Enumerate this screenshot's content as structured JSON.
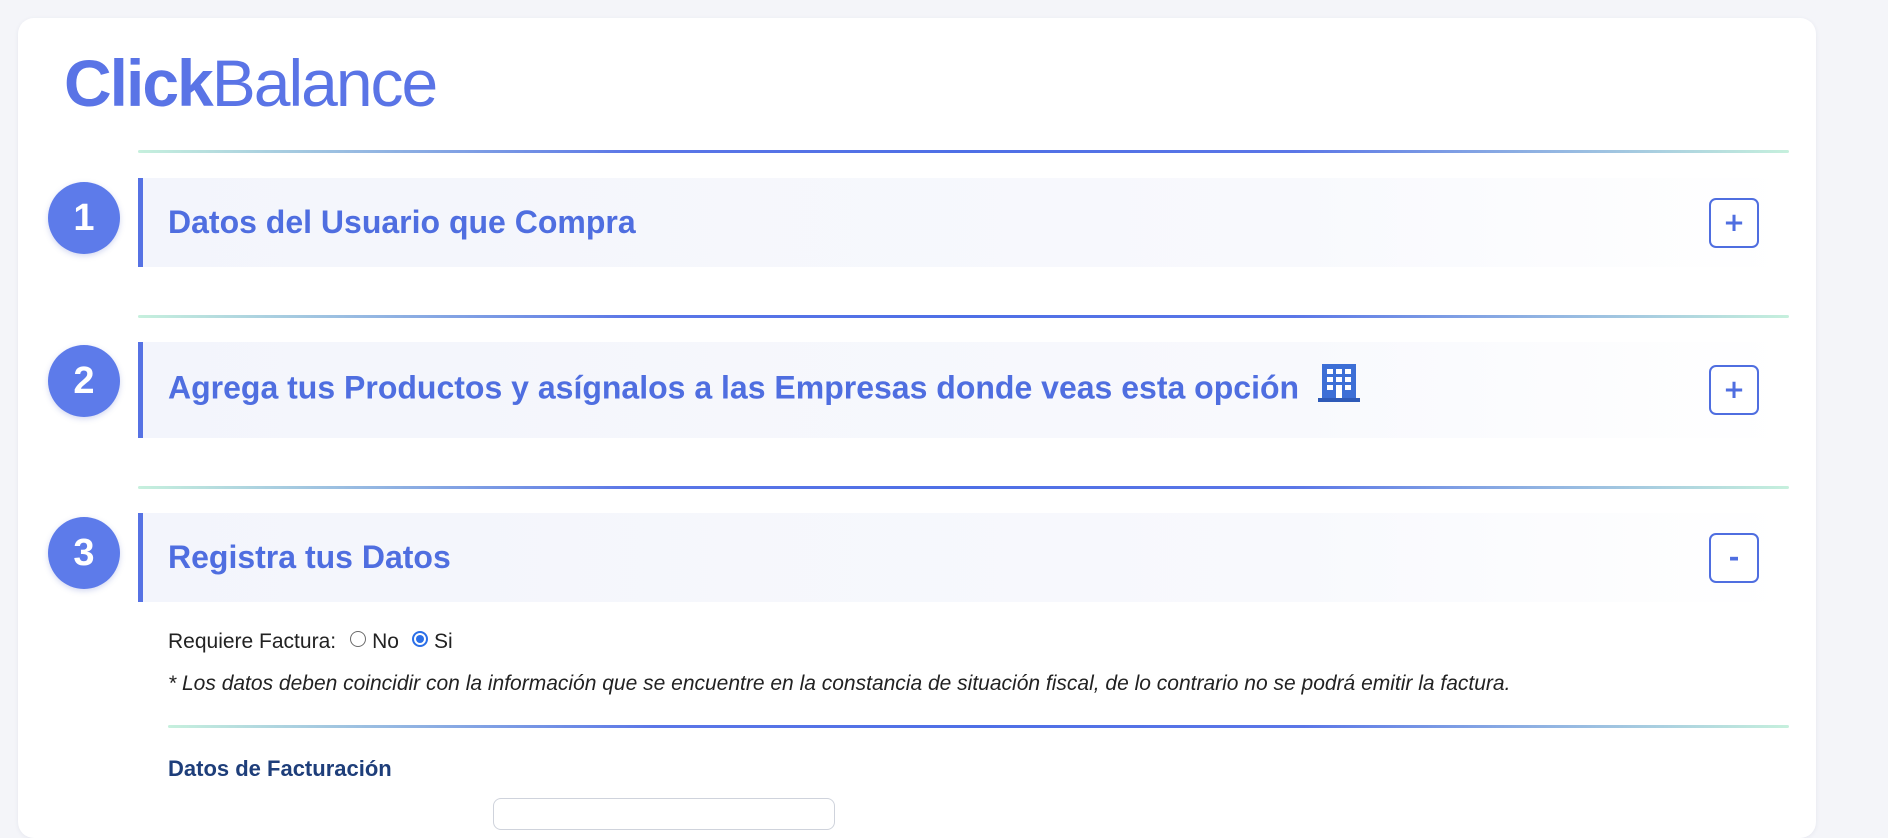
{
  "brand": {
    "logo_bold": "Click",
    "logo_light": "Balance"
  },
  "steps": [
    {
      "number": "1",
      "title": "Datos del Usuario que Compra",
      "toggle": "+"
    },
    {
      "number": "2",
      "title": "Agrega tus Productos y asígnalos a las Empresas donde veas esta opción",
      "toggle": "+",
      "icon": "building-icon"
    },
    {
      "number": "3",
      "title": "Registra tus Datos",
      "toggle": "-"
    }
  ],
  "invoice": {
    "label": "Requiere Factura:",
    "options": [
      {
        "label": "No",
        "checked": false
      },
      {
        "label": "Si",
        "checked": true
      }
    ],
    "note": "* Los datos deben coincidir con la información que se encuentre en la constancia de situación fiscal, de lo contrario no se podrá emitir la factura.",
    "billing_heading": "Datos de Facturación"
  },
  "colors": {
    "accent": "#4f6ee0",
    "step_circle": "#5d7bea",
    "heading_dark": "#1e3e7a",
    "radio_selected": "#2b6fe8"
  }
}
